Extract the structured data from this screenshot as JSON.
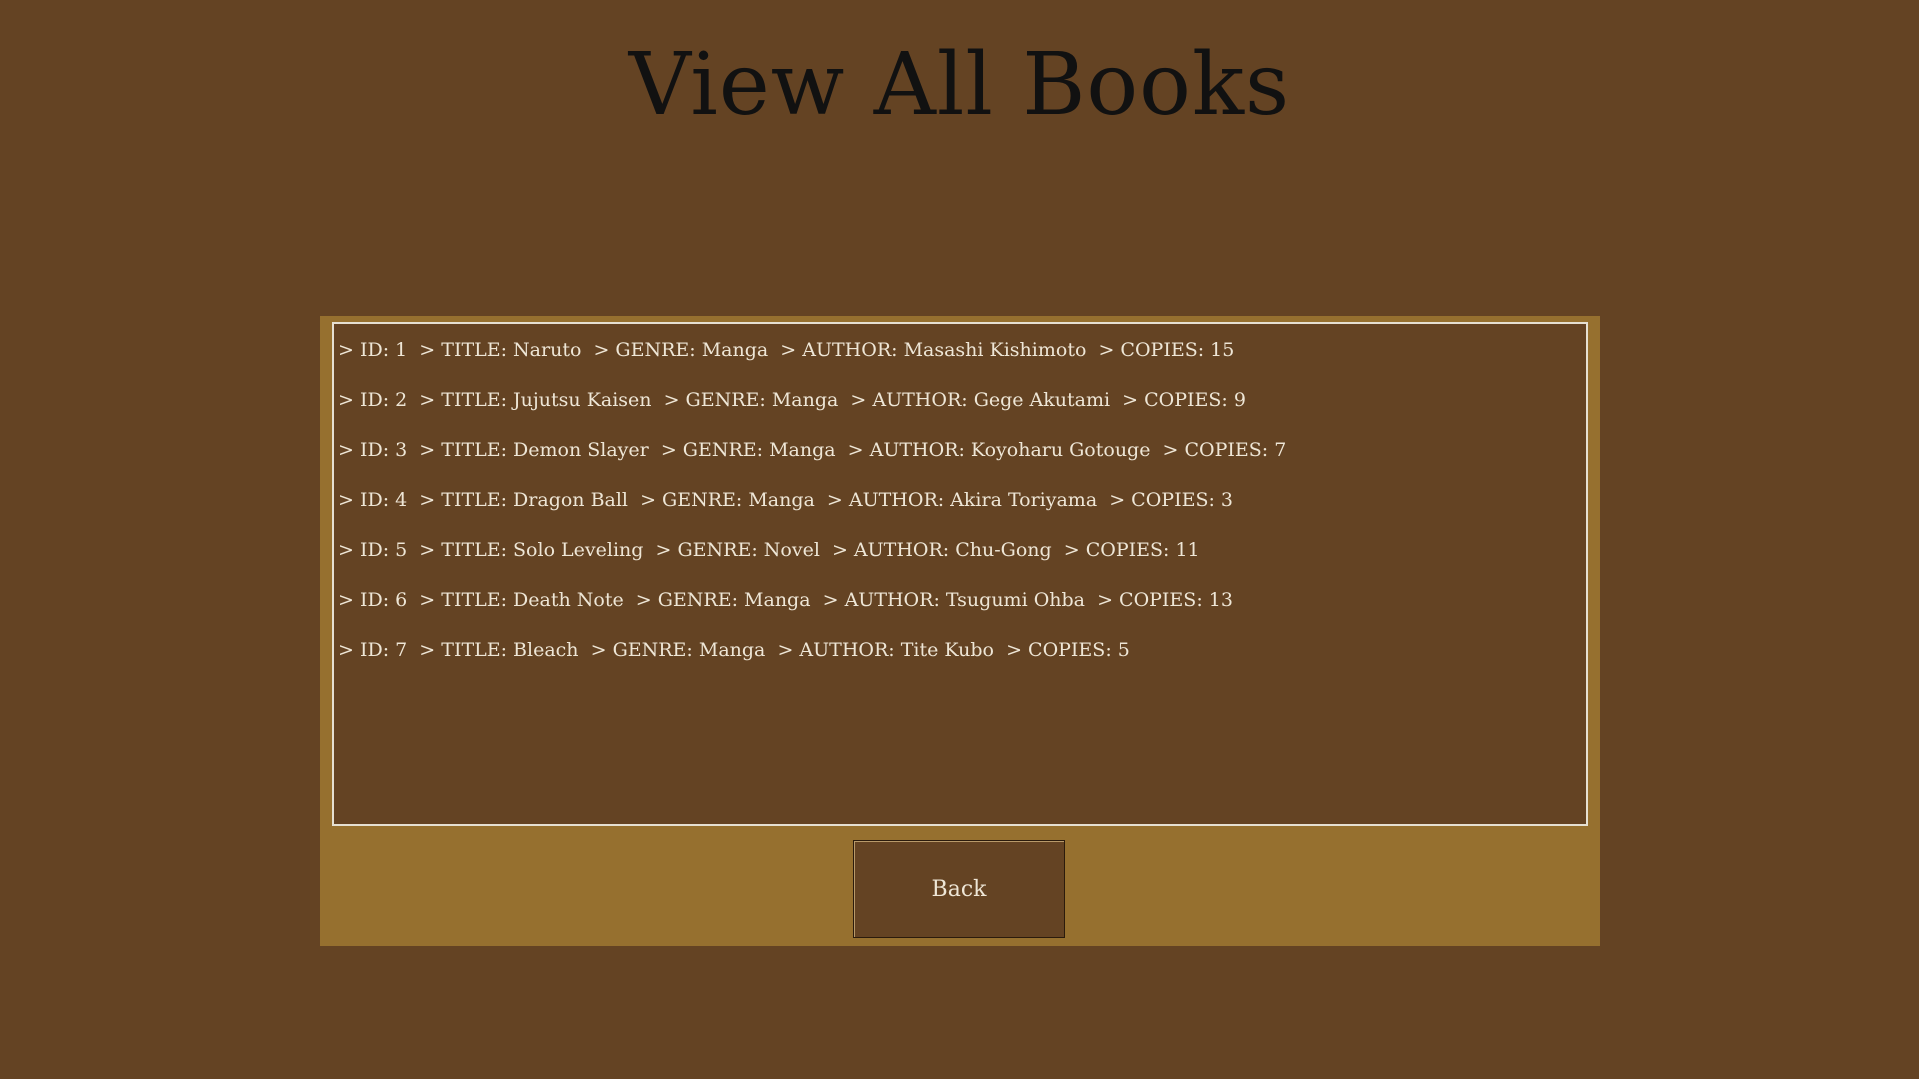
{
  "header": {
    "title": "View All Books"
  },
  "books": [
    "> ID: 1  > TITLE: Naruto  > GENRE: Manga  > AUTHOR: Masashi Kishimoto  > COPIES: 15",
    "> ID: 2  > TITLE: Jujutsu Kaisen  > GENRE: Manga  > AUTHOR: Gege Akutami  > COPIES: 9",
    "> ID: 3  > TITLE: Demon Slayer  > GENRE: Manga  > AUTHOR: Koyoharu Gotouge  > COPIES: 7",
    "> ID: 4  > TITLE: Dragon Ball  > GENRE: Manga  > AUTHOR: Akira Toriyama  > COPIES: 3",
    "> ID: 5  > TITLE: Solo Leveling  > GENRE: Novel  > AUTHOR: Chu-Gong  > COPIES: 11",
    "> ID: 6  > TITLE: Death Note  > GENRE: Manga  > AUTHOR: Tsugumi Ohba  > COPIES: 13",
    "> ID: 7  > TITLE: Bleach  > GENRE: Manga  > AUTHOR: Tite Kubo  > COPIES: 5"
  ],
  "buttons": {
    "back_label": "Back"
  },
  "colors": {
    "background": "#644323",
    "panel": "#96702f",
    "text": "#eee6d6",
    "title_text": "#111111"
  }
}
